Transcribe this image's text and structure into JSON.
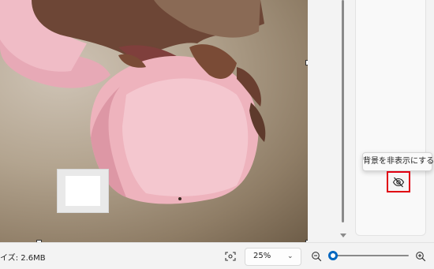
{
  "status_bar": {
    "image_size_text": "イズ: 2.6MB",
    "zoom_value": "25%",
    "zoom_fraction": 0.04
  },
  "tooltip": {
    "text": "背景を非表示にする"
  },
  "colors": {
    "accent": "#0067c0",
    "highlight_box": "#e00012",
    "blossom": "#eeb3bd",
    "sepal": "#7a4b36"
  },
  "icons": {
    "fit": "fit-to-screen-icon",
    "hide": "eye-slash-icon",
    "zoom_out": "zoom-out-icon",
    "zoom_in": "zoom-in-icon",
    "dropdown": "chevron-down-icon"
  }
}
